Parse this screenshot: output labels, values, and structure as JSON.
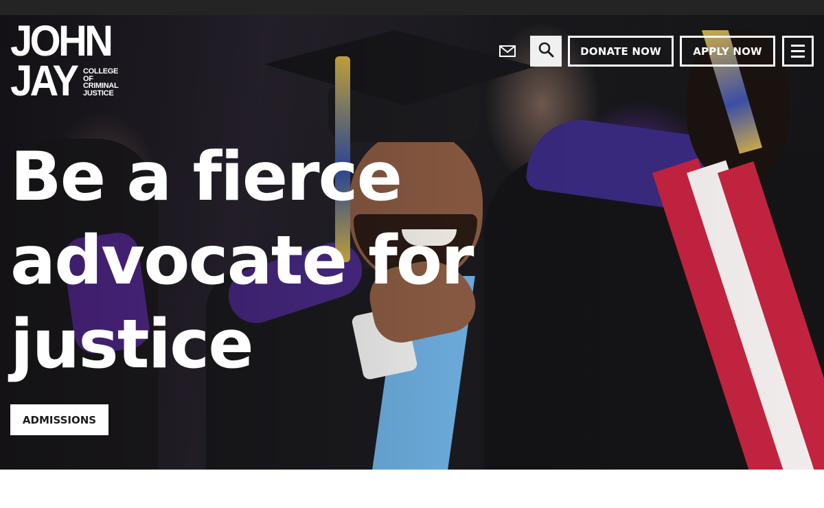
{
  "logo": {
    "line1": "JOHN",
    "line2": "JAY",
    "sub": [
      "COLLEGE",
      "OF",
      "CRIMINAL",
      "JUSTICE"
    ]
  },
  "header": {
    "mail_icon": "envelope-icon",
    "search_icon": "search-icon",
    "donate_label": "DONATE NOW",
    "apply_label": "APPLY NOW",
    "menu_icon": "hamburger-menu-icon"
  },
  "hero": {
    "headline": [
      "Be a fierce",
      "advocate for",
      "justice"
    ],
    "cta_label": "ADMISSIONS"
  },
  "colors": {
    "topbar": "#242424",
    "text_on_hero": "#ffffff",
    "search_button_bg": "#f0f0f0",
    "cta_bg": "#ffffff",
    "cta_text": "#1b1b1b"
  }
}
